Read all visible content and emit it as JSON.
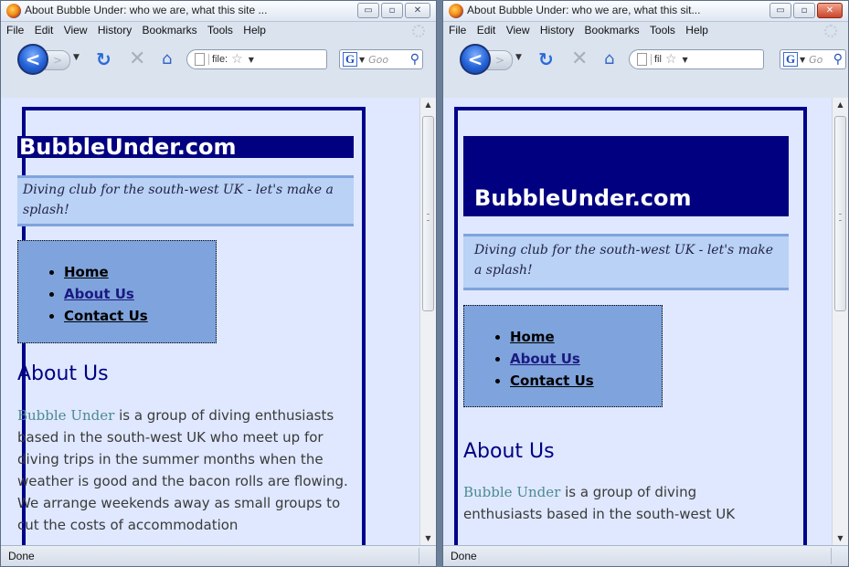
{
  "windows": [
    {
      "title": "About Bubble Under: who we are, what this site ...",
      "url_text": "file:",
      "search_placeholder": "Goo"
    },
    {
      "title": "About Bubble Under: who we are, what this sit...",
      "url_text": "fil",
      "search_placeholder": "Go"
    }
  ],
  "menu": {
    "file": "File",
    "edit": "Edit",
    "view": "View",
    "history": "History",
    "bookmarks": "Bookmarks",
    "tools": "Tools",
    "help": "Help"
  },
  "status": "Done",
  "page": {
    "site_title": "BubbleUnder.com",
    "tagline": "Diving club for the south-west UK - let's make a splash!",
    "nav": {
      "home": "Home",
      "about": "About Us",
      "contact": "Contact Us"
    },
    "heading": "About Us",
    "brand": "Bubble Under",
    "body_left": " is a group of diving enthusiasts based in the south-west UK who meet up for diving trips in the summer months when the weather is good and the bacon rolls are flowing. We arrange weekends away as small groups to cut the costs of accommodation",
    "body_right": " is a group of diving enthusiasts based in the south-west UK"
  },
  "icons": {
    "back": "back-arrow-icon",
    "forward": "forward-arrow-icon",
    "reload": "reload-icon",
    "stop": "stop-icon",
    "home": "home-icon",
    "bookmark_star": "star-icon",
    "search": "magnifier-icon",
    "google": "google-icon"
  },
  "colors": {
    "title_bg": "#000080",
    "wrapper_border": "#00008b",
    "tagline_bg": "#b9d2f5",
    "nav_bg": "#7fa3dc",
    "page_bg": "#dfe8ff",
    "brand_text": "#4d8a8f"
  }
}
